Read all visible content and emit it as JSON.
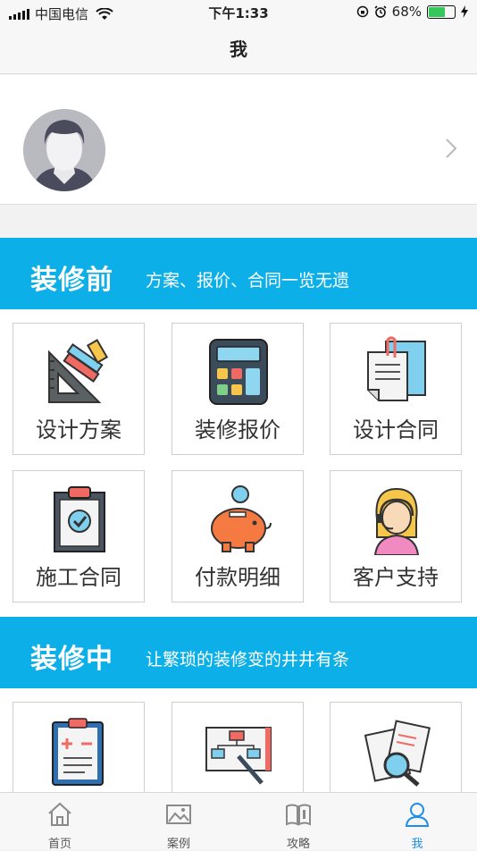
{
  "status_bar": {
    "carrier": "中国电信",
    "time": "下午1:33",
    "battery_percent": "68%",
    "battery_level": 0.68
  },
  "nav": {
    "title": "我"
  },
  "section_before": {
    "title": "装修前",
    "subtitle": "方案、报价、合同一览无遗",
    "items": [
      {
        "label": "设计方案",
        "icon": "design-plan-icon"
      },
      {
        "label": "装修报价",
        "icon": "calculator-icon"
      },
      {
        "label": "设计合同",
        "icon": "contract-document-icon"
      },
      {
        "label": "施工合同",
        "icon": "clipboard-check-icon"
      },
      {
        "label": "付款明细",
        "icon": "piggy-bank-icon"
      },
      {
        "label": "客户支持",
        "icon": "support-agent-icon"
      }
    ]
  },
  "section_during": {
    "title": "装修中",
    "subtitle": "让繁琐的装修变的井井有条",
    "items": [
      {
        "icon": "calculation-clipboard-icon"
      },
      {
        "icon": "flowchart-board-icon"
      },
      {
        "icon": "document-search-icon"
      }
    ]
  },
  "tab_bar": {
    "tabs": [
      {
        "label": "首页",
        "icon": "home-icon"
      },
      {
        "label": "案例",
        "icon": "image-icon"
      },
      {
        "label": "攻略",
        "icon": "book-icon"
      },
      {
        "label": "我",
        "icon": "user-icon",
        "active": true
      }
    ]
  },
  "colors": {
    "accent": "#0dafe8",
    "active_tab": "#1f8ee8"
  }
}
